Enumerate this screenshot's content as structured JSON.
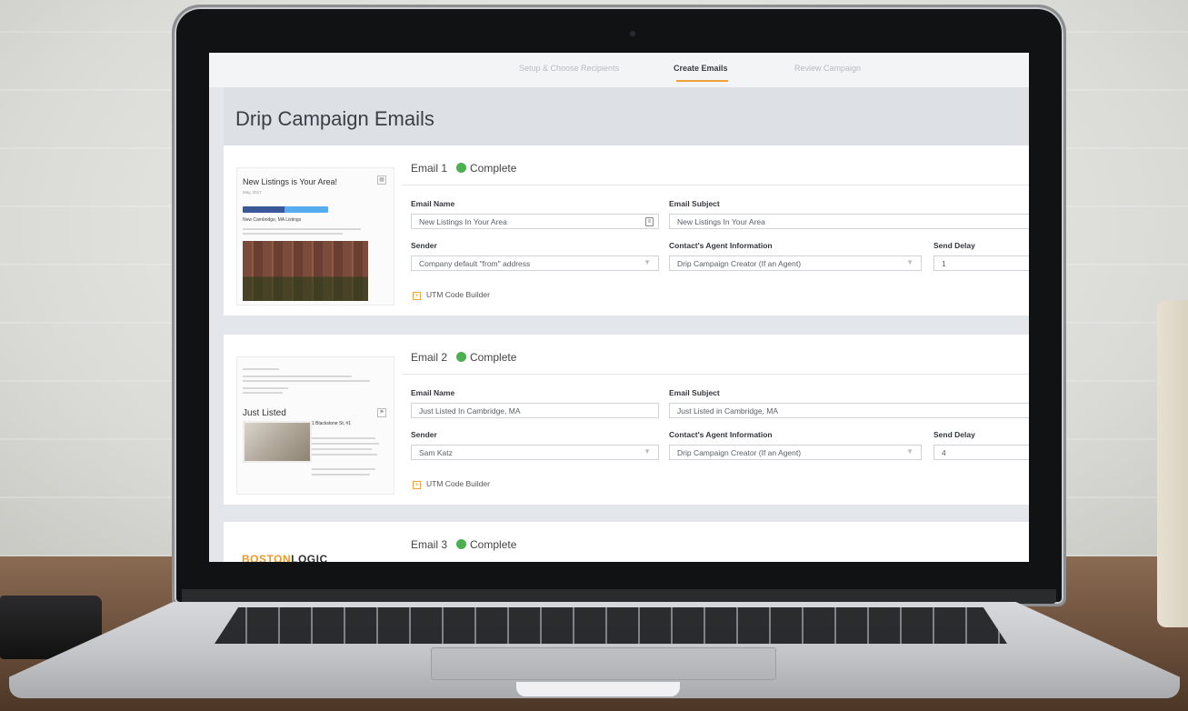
{
  "steps": [
    {
      "label": "Setup & Choose Recipients"
    },
    {
      "label": "Create Emails"
    },
    {
      "label": "Review Campaign"
    }
  ],
  "page_title": "Drip Campaign Emails",
  "field_labels": {
    "email_name": "Email Name",
    "email_subject": "Email Subject",
    "sender": "Sender",
    "agent_info": "Contact's Agent Information",
    "send_delay": "Send Delay"
  },
  "utm_label": "UTM Code Builder",
  "emails": [
    {
      "heading": "Email 1",
      "status": "Complete",
      "name": "New Listings In Your Area",
      "subject": "New Listings In Your Area",
      "sender": "Company default \"from\" address",
      "agent_info": "Drip Campaign Creator (If an Agent)",
      "send_delay": "1",
      "preview": {
        "title": "New Listings is Your Area!",
        "date": "May, 2017",
        "subheading": "New Cambridge, MA Listings"
      }
    },
    {
      "heading": "Email 2",
      "status": "Complete",
      "name": "Just Listed In Cambridge, MA",
      "subject": "Just Listed in Cambridge, MA",
      "sender": "Sam Katz",
      "agent_info": "Drip Campaign Creator (If an Agent)",
      "send_delay": "4",
      "preview": {
        "title": "Just Listed",
        "address": "1 Blackstone St, #1"
      }
    },
    {
      "heading": "Email 3",
      "status": "Complete",
      "preview": {
        "logo_part1": "BOSTON",
        "logo_part2": "LOGIC"
      }
    }
  ],
  "colors": {
    "accent": "#f0a33a",
    "status_complete": "#4caf50",
    "title_bar": "#dde1e6"
  },
  "icons": [
    "edit-icon",
    "chevron-down-icon",
    "plus-square-icon",
    "calendar-icon",
    "flag-icon"
  ]
}
